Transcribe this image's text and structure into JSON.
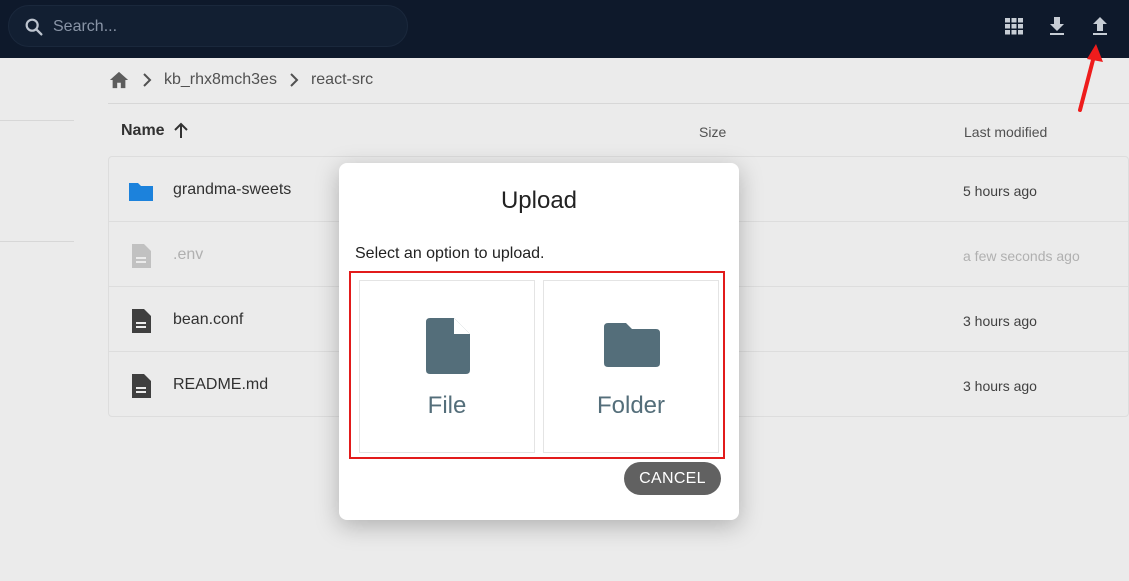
{
  "topbar": {
    "search_placeholder": "Search...",
    "icons": [
      "grid-view-icon",
      "download-icon",
      "upload-icon"
    ]
  },
  "breadcrumb": {
    "items": [
      "kb_rhx8mch3es",
      "react-src"
    ]
  },
  "table": {
    "headers": {
      "name": "Name",
      "size": "Size",
      "modified": "Last modified"
    },
    "rows": [
      {
        "name": "grandma-sweets",
        "icon": "folder-icon",
        "modified": "5 hours ago",
        "dimmed": false
      },
      {
        "name": ".env",
        "icon": "file-icon",
        "modified": "a few seconds ago",
        "dimmed": true
      },
      {
        "name": "bean.conf",
        "icon": "file-icon",
        "modified": "3 hours ago",
        "dimmed": false
      },
      {
        "name": "README.md",
        "icon": "file-icon",
        "modified": "3 hours ago",
        "dimmed": false
      }
    ]
  },
  "dialog": {
    "title": "Upload",
    "subtitle": "Select an option to upload.",
    "options": {
      "file": "File",
      "folder": "Folder"
    },
    "cancel": "CANCEL"
  },
  "colors": {
    "topbar": "#0f1b2d",
    "folder_blue": "#1e88e5",
    "option_icon": "#546e7a",
    "highlight_red": "#e21b1b",
    "cancel_bg": "#616161"
  }
}
